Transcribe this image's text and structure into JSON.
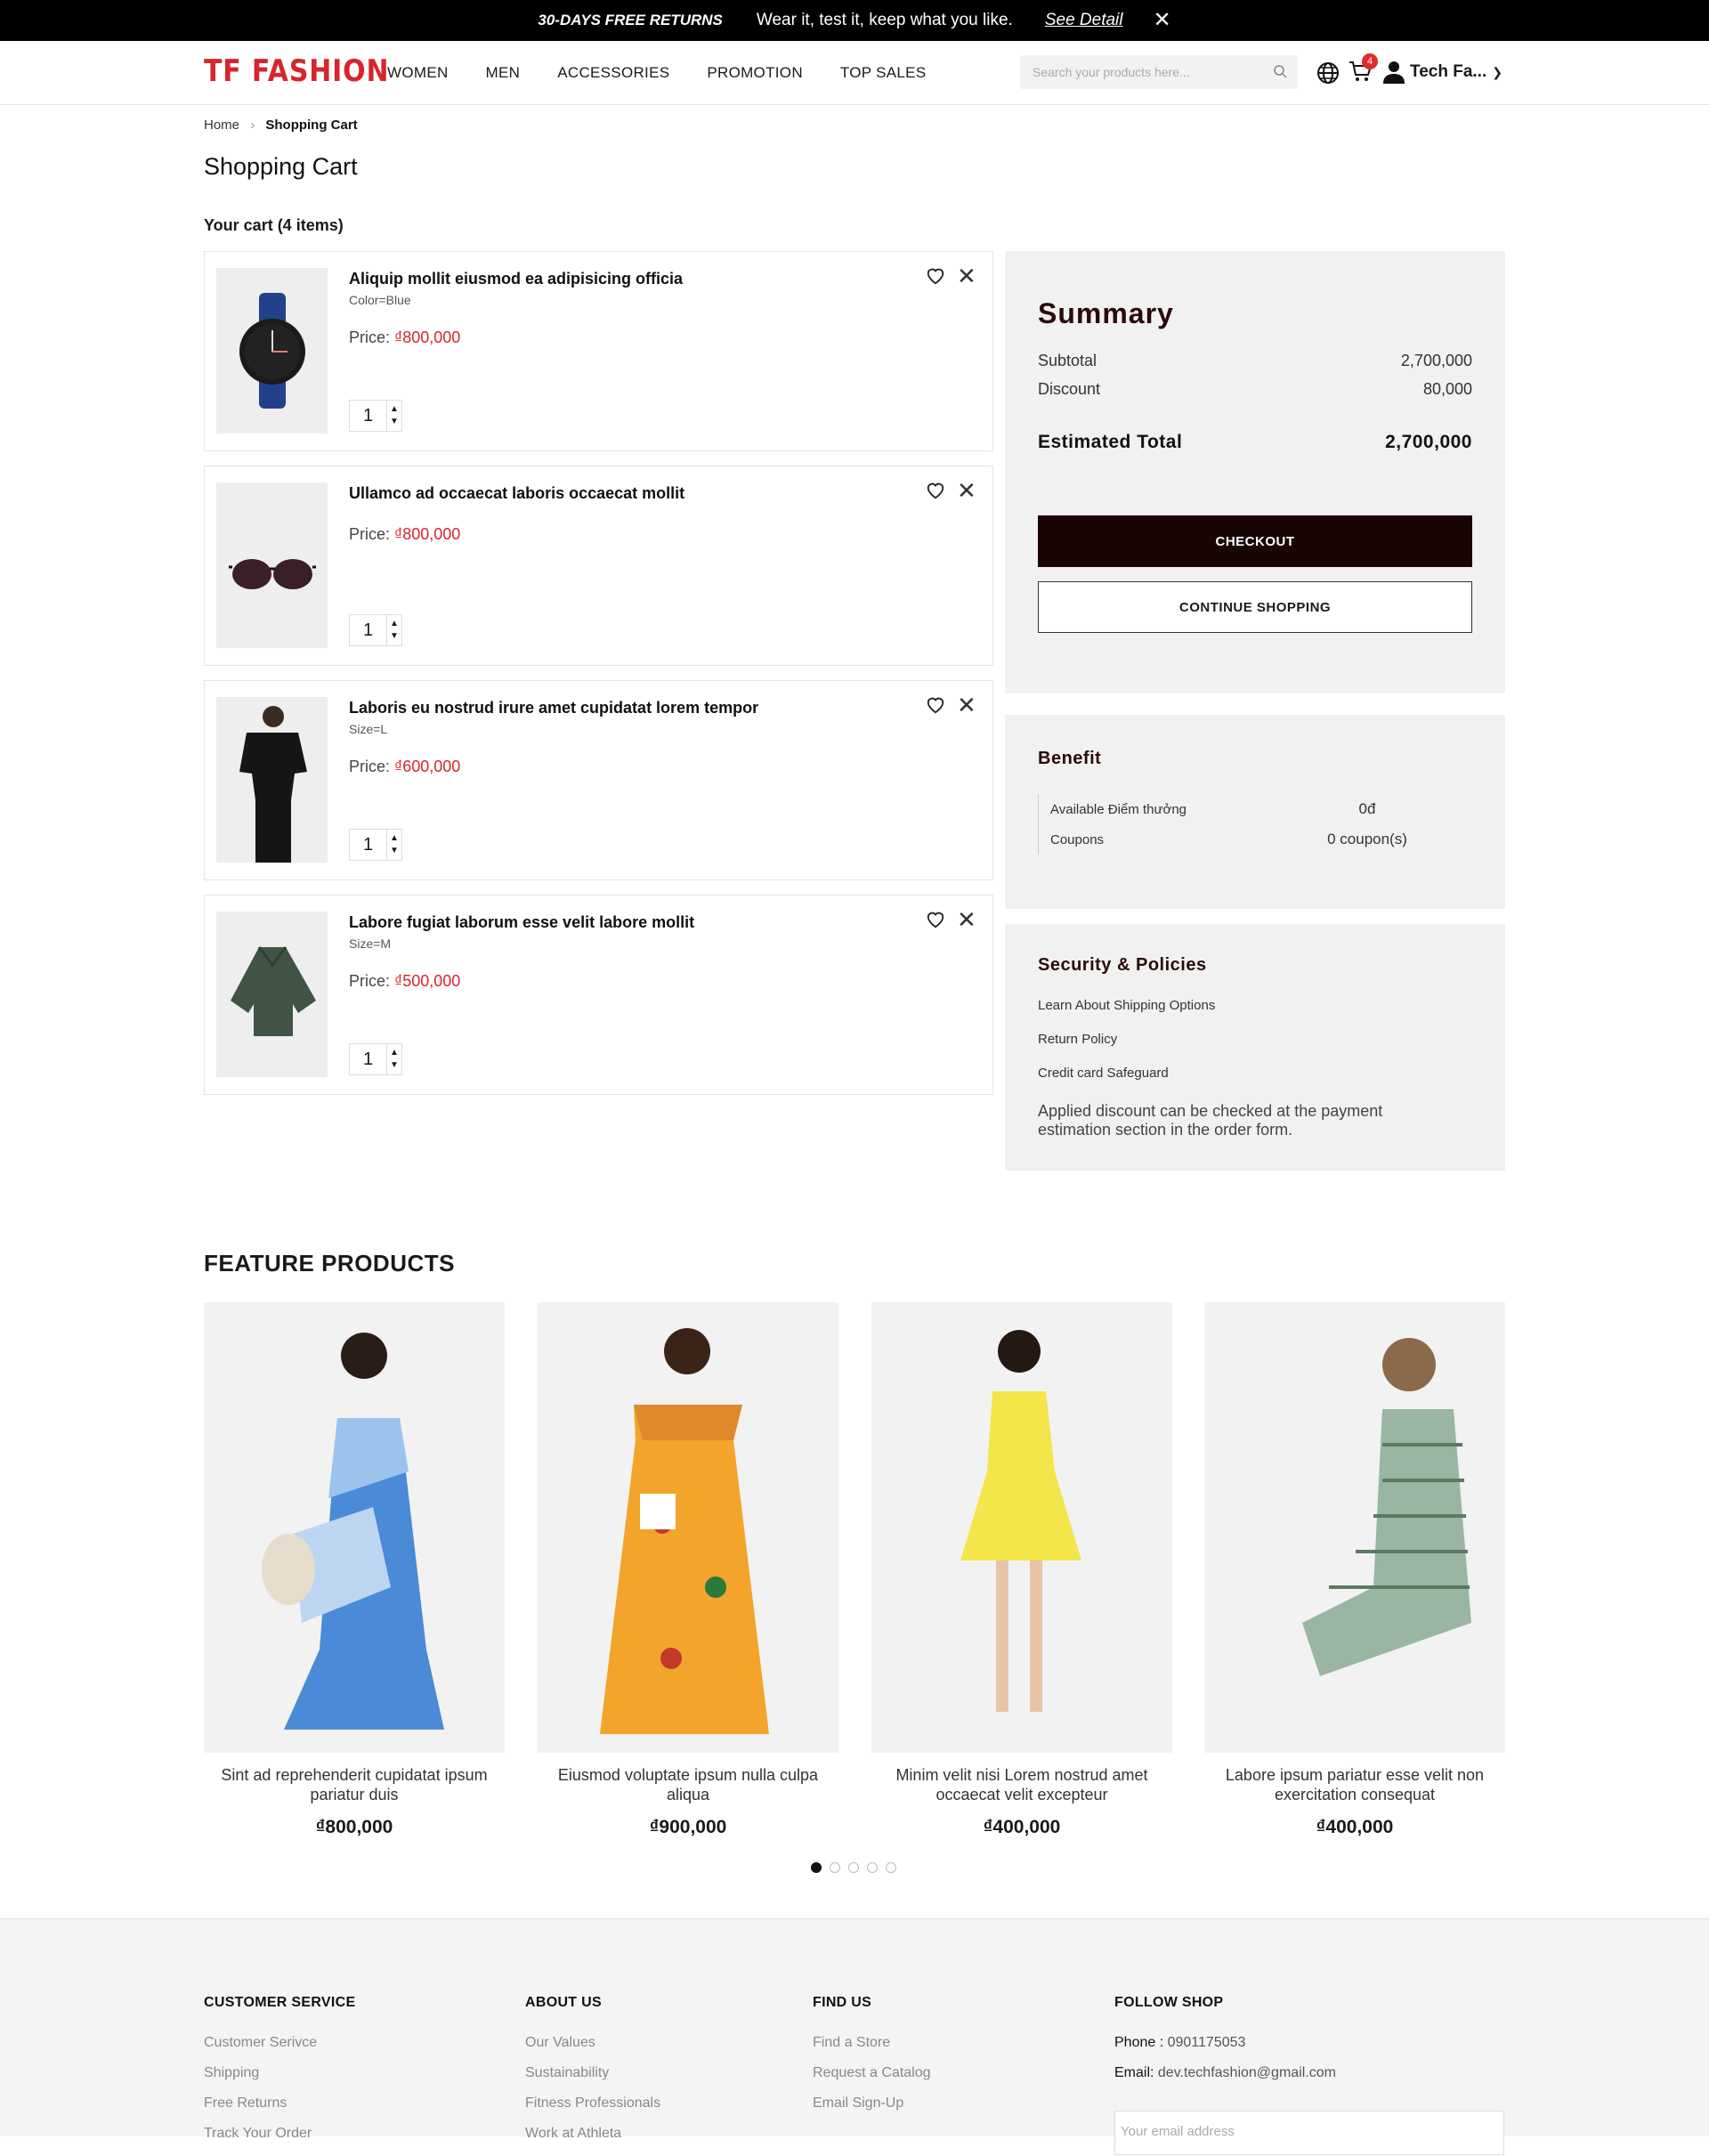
{
  "topbar": {
    "promo": "30-DAYS FREE RETURNS",
    "message": "Wear it, test it, keep what you like.",
    "detail_link": "See Detail"
  },
  "header": {
    "logo": "TF FASHION",
    "nav": [
      "WOMEN",
      "MEN",
      "ACCESSORIES",
      "PROMOTION",
      "TOP SALES"
    ],
    "search_placeholder": "Search your products here...",
    "cart_count": "4",
    "user_name": "Tech Fa..."
  },
  "breadcrumb": {
    "home": "Home",
    "current": "Shopping Cart"
  },
  "page_title": "Shopping Cart",
  "cart": {
    "heading": "Your cart (4 items)",
    "price_label": "Price: ",
    "items": [
      {
        "name": "Aliquip mollit eiusmod ea adipisicing officia",
        "variant": "Color=Blue",
        "price": "₫800,000",
        "qty": "1"
      },
      {
        "name": "Ullamco ad occaecat laboris occaecat mollit",
        "variant": "",
        "price": "₫800,000",
        "qty": "1"
      },
      {
        "name": "Laboris eu nostrud irure amet cupidatat lorem tempor",
        "variant": "Size=L",
        "price": "₫600,000",
        "qty": "1"
      },
      {
        "name": "Labore fugiat laborum esse velit labore mollit",
        "variant": "Size=M",
        "price": "₫500,000",
        "qty": "1"
      }
    ]
  },
  "summary": {
    "title": "Summary",
    "subtotal_label": "Subtotal",
    "subtotal": "2,700,000",
    "discount_label": "Discount",
    "discount": "80,000",
    "total_label": "Estimated Total",
    "total": "2,700,000",
    "checkout": "CHECKOUT",
    "continue": "CONTINUE SHOPPING"
  },
  "benefit": {
    "title": "Benefit",
    "points_label": "Available Điểm thưởng",
    "points": "0đ",
    "coupons_label": "Coupons",
    "coupons": "0 coupon(s)"
  },
  "security": {
    "title": "Security & Policies",
    "links": [
      "Learn About Shipping Options",
      "Return Policy",
      "Credit card Safeguard"
    ],
    "note": "Applied discount can be checked at the payment estimation section in the order form."
  },
  "featured": {
    "title": "FEATURE PRODUCTS",
    "products": [
      {
        "name": "Sint ad reprehenderit cupidatat ipsum pariatur duis",
        "price": "₫800,000"
      },
      {
        "name": "Eiusmod voluptate ipsum nulla culpa aliqua",
        "price": "₫900,000"
      },
      {
        "name": "Minim velit nisi Lorem nostrud amet occaecat velit excepteur",
        "price": "₫400,000"
      },
      {
        "name": "Labore ipsum pariatur esse velit non exercitation consequat",
        "price": "₫400,000"
      }
    ],
    "active_page": 1,
    "pages": 5
  },
  "footer": {
    "customer_service": {
      "title": "CUSTOMER SERVICE",
      "links": [
        "Customer Serivce",
        "Shipping",
        "Free Returns",
        "Track Your Order"
      ]
    },
    "about": {
      "title": "ABOUT US",
      "links": [
        "Our Values",
        "Sustainability",
        "Fitness Professionals",
        "Work at Athleta"
      ]
    },
    "find": {
      "title": "FIND US",
      "links": [
        "Find a Store",
        "Request a Catalog",
        "Email Sign-Up"
      ]
    },
    "follow": {
      "title": "FOLLOW SHOP",
      "phone_label": "Phone : ",
      "phone": "0901175053",
      "email_label": "Email: ",
      "email": "dev.techfashion@gmail.com",
      "email_placeholder": "Your email address"
    }
  },
  "colors": {
    "brand": "#d6262b",
    "dark_button": "#1a0505",
    "panel_bg": "#f2f1f1"
  }
}
